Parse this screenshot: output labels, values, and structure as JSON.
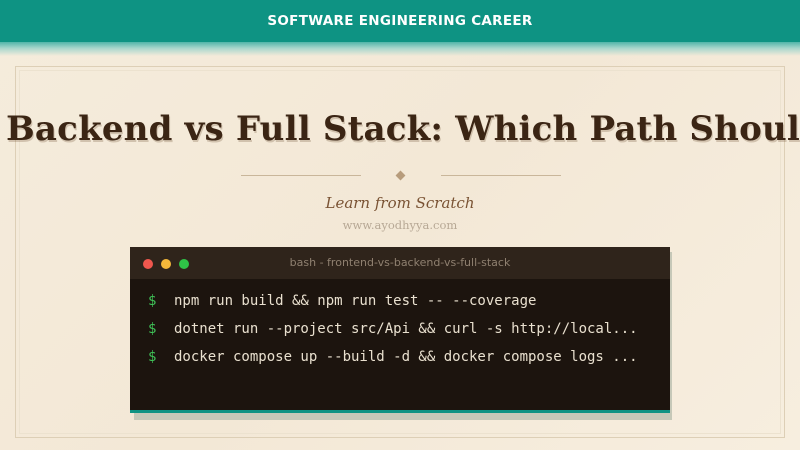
{
  "banner": {
    "text": "SOFTWARE ENGINEERING CAREER"
  },
  "title": {
    "text": "Backend vs Full Stack: Which Path Should Y"
  },
  "subtitle": {
    "text": "Learn from Scratch"
  },
  "site": {
    "text": "www.ayodhyya.com"
  },
  "terminal": {
    "title": "bash - frontend-vs-backend-vs-full-stack",
    "lines": [
      {
        "prompt": "$",
        "command": "npm run build && npm run test -- --coverage"
      },
      {
        "prompt": "$",
        "command": "dotnet run --project src/Api && curl -s http://local..."
      },
      {
        "prompt": "$",
        "command": "docker compose up --build -d && docker compose logs ..."
      }
    ]
  },
  "colors": {
    "accent": "#0e9383",
    "background": "#f5ecdc",
    "title": "#3b2514",
    "terminal_bg": "#1c140e",
    "prompt": "#3fc157"
  }
}
